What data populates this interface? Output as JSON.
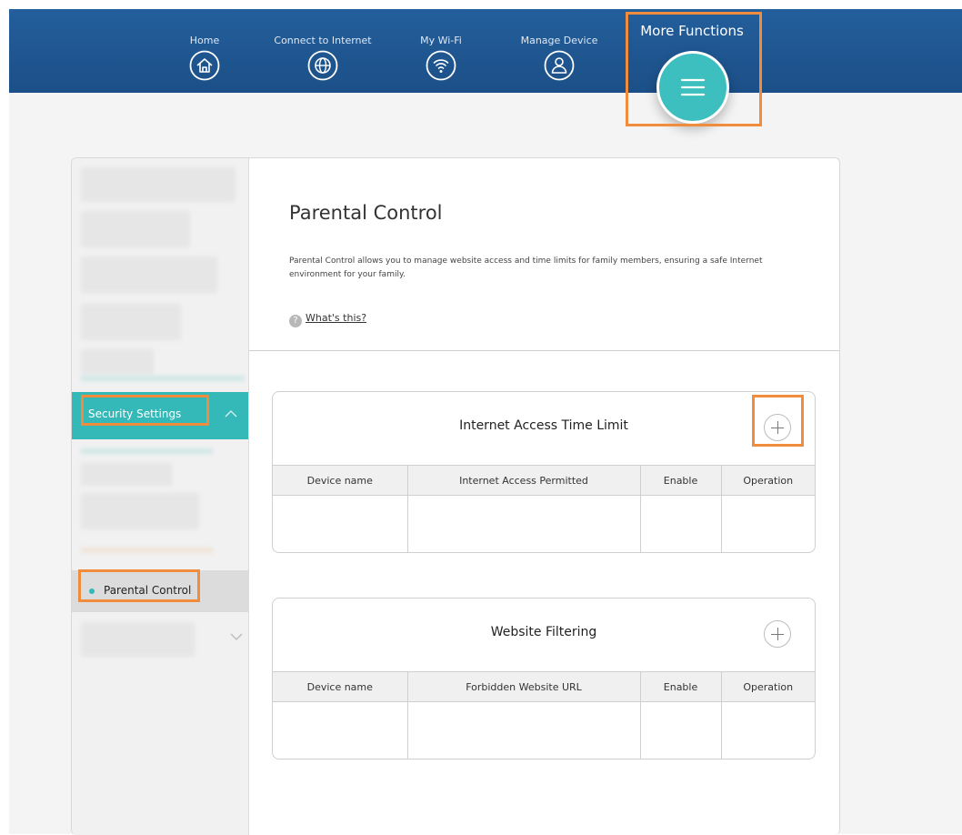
{
  "nav": {
    "items": [
      {
        "label": "Home",
        "icon": "home-icon"
      },
      {
        "label": "Connect to Internet",
        "icon": "globe-icon"
      },
      {
        "label": "My Wi-Fi",
        "icon": "wifi-icon"
      },
      {
        "label": "Manage Device",
        "icon": "user-icon"
      }
    ],
    "more_label": "More Functions"
  },
  "sidebar": {
    "security_label": "Security Settings",
    "parental_label": "Parental Control"
  },
  "main": {
    "title": "Parental Control",
    "description": "Parental Control allows you to manage website access and time limits for family members, ensuring a safe Internet environment for your family.",
    "help_icon": "?",
    "help_link": "What's this?"
  },
  "sections": [
    {
      "title": "Internet Access Time Limit",
      "columns": [
        "Device name",
        "Internet Access Permitted",
        "Enable",
        "Operation"
      ]
    },
    {
      "title": "Website Filtering",
      "columns": [
        "Device name",
        "Forbidden Website URL",
        "Enable",
        "Operation"
      ]
    }
  ],
  "colors": {
    "nav_bg": "#1f5592",
    "accent_teal": "#34b8b8",
    "highlight": "#f08c3c"
  }
}
